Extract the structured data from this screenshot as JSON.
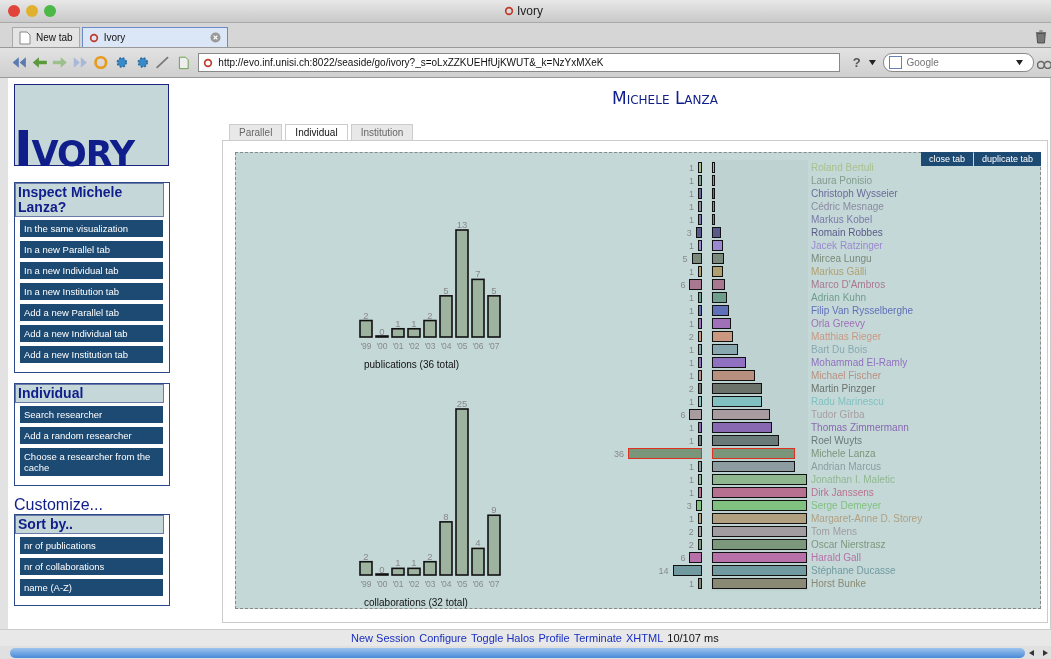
{
  "window": {
    "title": "Ivory"
  },
  "browser_tabs": [
    {
      "label": "New tab",
      "selected": false
    },
    {
      "label": "Ivory",
      "selected": true
    }
  ],
  "address_bar": {
    "value": "http://evo.inf.unisi.ch:8022/seaside/go/ivory?_s=oLxZZKUEHfUjKWUT&_k=NzYxMXeK"
  },
  "search": {
    "placeholder": "Google"
  },
  "help_button": "?",
  "sidebar": {
    "logo": "Ivory",
    "sections": [
      {
        "title": "Inspect Michele Lanza?",
        "items": [
          "In the same visualization",
          "In a new Parallel tab",
          "In a new Individual tab",
          "In a new Institution tab",
          "Add a new Parallel tab",
          "Add a new Individual tab",
          "Add a new Institution tab"
        ]
      },
      {
        "title": "Individual",
        "items": [
          "Search researcher",
          "Add a random researcher",
          "Choose a researcher from the cache"
        ]
      },
      {
        "heading": "Customize...",
        "title": "Sort by..",
        "items": [
          "nr of publications",
          "nr of collaborations",
          "name (A-Z)"
        ]
      }
    ]
  },
  "page": {
    "heading": "Michele Lanza",
    "tabs": [
      {
        "label": "Parallel",
        "selected": false
      },
      {
        "label": "Individual",
        "selected": true
      },
      {
        "label": "Institution",
        "selected": false
      }
    ],
    "actions": [
      "close tab",
      "duplicate tab"
    ],
    "charts": [
      {
        "caption": "publications (36 total)",
        "chart_data": {
          "type": "bar",
          "categories": [
            "'99",
            "'00",
            "'01",
            "'02",
            "'03",
            "'04",
            "'05",
            "'06",
            "'07"
          ],
          "values": [
            2,
            0,
            1,
            1,
            2,
            5,
            13,
            7,
            5
          ],
          "data_labels": true
        }
      },
      {
        "caption": "collaborations (32 total)",
        "chart_data": {
          "type": "bar",
          "categories": [
            "'99",
            "'00",
            "'01",
            "'02",
            "'03",
            "'04",
            "'05",
            "'06",
            "'07"
          ],
          "values": [
            2,
            0,
            1,
            1,
            2,
            8,
            25,
            4,
            9
          ],
          "data_labels": true
        }
      }
    ],
    "collaborators": [
      {
        "name": "Roland Bertuli",
        "count": "1",
        "level": 0.03,
        "color": "#a9c08c",
        "selected": false
      },
      {
        "name": "Laura Ponisio",
        "count": "1",
        "level": 0.03,
        "color": "#7f9c8c",
        "selected": false
      },
      {
        "name": "Christoph Wysseier",
        "count": "1",
        "level": 0.03,
        "color": "#6a6a9a",
        "selected": false
      },
      {
        "name": "Cédric Mesnage",
        "count": "1",
        "level": 0.03,
        "color": "#8a8aa0",
        "selected": false
      },
      {
        "name": "Markus Kobel",
        "count": "1",
        "level": 0.03,
        "color": "#7a7aa8",
        "selected": false
      },
      {
        "name": "Romain Robbes",
        "count": "3",
        "level": 0.09,
        "color": "#5a5a8a",
        "selected": false
      },
      {
        "name": "Jacek Ratzinger",
        "count": "1",
        "level": 0.12,
        "color": "#9a88d0",
        "selected": false
      },
      {
        "name": "Mircea Lungu",
        "count": "5",
        "level": 0.13,
        "color": "#7a8a7a",
        "selected": false
      },
      {
        "name": "Markus Gälli",
        "count": "1",
        "level": 0.12,
        "color": "#b0a070",
        "selected": false
      },
      {
        "name": "Marco D'Ambros",
        "count": "6",
        "level": 0.14,
        "color": "#a87890",
        "selected": false
      },
      {
        "name": "Adrian Kuhn",
        "count": "1",
        "level": 0.16,
        "color": "#6f9e8c",
        "selected": false
      },
      {
        "name": "Filip Van Rysselberghe",
        "count": "1",
        "level": 0.18,
        "color": "#6070b8",
        "selected": false
      },
      {
        "name": "Orla Greevy",
        "count": "1",
        "level": 0.2,
        "color": "#a070b8",
        "selected": false
      },
      {
        "name": "Matthias Rieger",
        "count": "2",
        "level": 0.22,
        "color": "#c89880",
        "selected": false
      },
      {
        "name": "Bart Du Bois",
        "count": "1",
        "level": 0.27,
        "color": "#88a8b0",
        "selected": false
      },
      {
        "name": "Mohammad El-Ramly",
        "count": "1",
        "level": 0.36,
        "color": "#9070c0",
        "selected": false
      },
      {
        "name": "Michael Fischer",
        "count": "1",
        "level": 0.45,
        "color": "#b89080",
        "selected": false
      },
      {
        "name": "Martin Pinzger",
        "count": "2",
        "level": 0.53,
        "color": "#6a726a",
        "selected": false
      },
      {
        "name": "Radu Marinescu",
        "count": "1",
        "level": 0.53,
        "color": "#80c0c0",
        "selected": false
      },
      {
        "name": "Tudor Gîrba",
        "count": "6",
        "level": 0.61,
        "color": "#a89ca0",
        "selected": false
      },
      {
        "name": "Thomas Zimmermann",
        "count": "1",
        "level": 0.63,
        "color": "#8868b0",
        "selected": false
      },
      {
        "name": "Roel Wuyts",
        "count": "1",
        "level": 0.7,
        "color": "#6a7a78",
        "selected": false
      },
      {
        "name": "Michele Lanza",
        "count": "36",
        "level": 0.87,
        "color": "#7a967a",
        "selected": true
      },
      {
        "name": "Andrian Marcus",
        "count": "1",
        "level": 0.87,
        "color": "#8c9ca0",
        "selected": false
      },
      {
        "name": "Jonathan I. Maletic",
        "count": "1",
        "level": 1,
        "color": "#90b890",
        "selected": false
      },
      {
        "name": "Dirk Janssens",
        "count": "1",
        "level": 1,
        "color": "#b87090",
        "selected": false
      },
      {
        "name": "Serge Demeyer",
        "count": "3",
        "level": 1,
        "color": "#80c080",
        "selected": false
      },
      {
        "name": "Margaret-Anne D. Storey",
        "count": "1",
        "level": 1,
        "color": "#b0a080",
        "selected": false
      },
      {
        "name": "Tom Mens",
        "count": "2",
        "level": 1,
        "color": "#a09ca0",
        "selected": false
      },
      {
        "name": "Oscar Nierstrasz",
        "count": "2",
        "level": 1,
        "color": "#7c987c",
        "selected": false
      },
      {
        "name": "Harald Gall",
        "count": "6",
        "level": 1,
        "color": "#b870a8",
        "selected": false
      },
      {
        "name": "Stéphane Ducasse",
        "count": "14",
        "level": 1,
        "color": "#709aa0",
        "selected": false
      },
      {
        "name": "Horst Bunke",
        "count": "1",
        "level": 1,
        "color": "#8a8a74",
        "selected": false
      }
    ]
  },
  "footer": {
    "links": [
      "New Session",
      "Configure",
      "Toggle Halos",
      "Profile",
      "Terminate",
      "XHTML"
    ],
    "timing": "10/107 ms"
  }
}
